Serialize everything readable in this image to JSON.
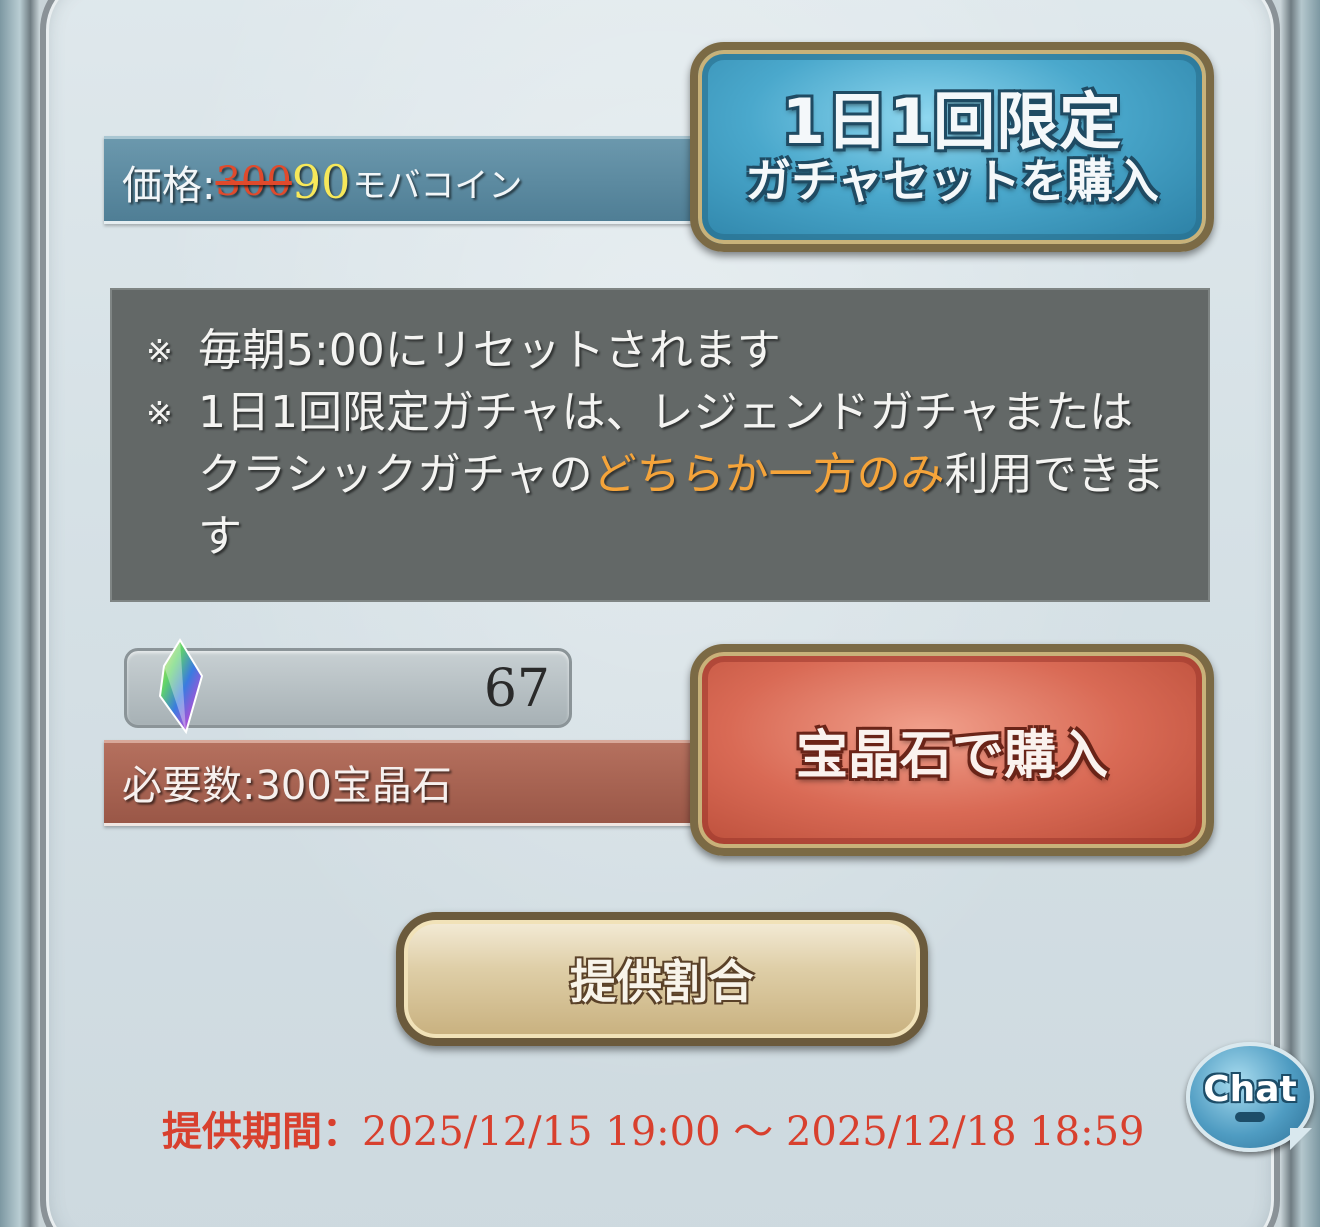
{
  "price": {
    "label": "価格:",
    "old_value": "300",
    "new_value": "90",
    "unit": "モバコイン"
  },
  "buttons": {
    "daily_line1": "1日1回限定",
    "daily_line2": "ガチャセットを購入",
    "crystal": "宝晶石で購入",
    "rates": "提供割合"
  },
  "notice": {
    "mark": "※",
    "line1": "毎朝5:00にリセットされます",
    "line2_before": "1日1回限定ガチャは、レジェンドガチャまたはクラシックガチャの",
    "line2_highlight": "どちらか一方のみ",
    "line2_after": "利用できます",
    "highlight_color": "#f5a43a"
  },
  "crystals": {
    "icon": "crystal-icon",
    "count": "67"
  },
  "required": {
    "text": "必要数:300宝晶石"
  },
  "period": {
    "label": "提供期間：",
    "range": "2025/12/15 19:00 〜 2025/12/18 18:59"
  },
  "chat": {
    "label": "Chat"
  },
  "colors": {
    "accent_red": "#d8402e",
    "price_new": "#f7e85a",
    "price_old": "#e04a2c"
  }
}
